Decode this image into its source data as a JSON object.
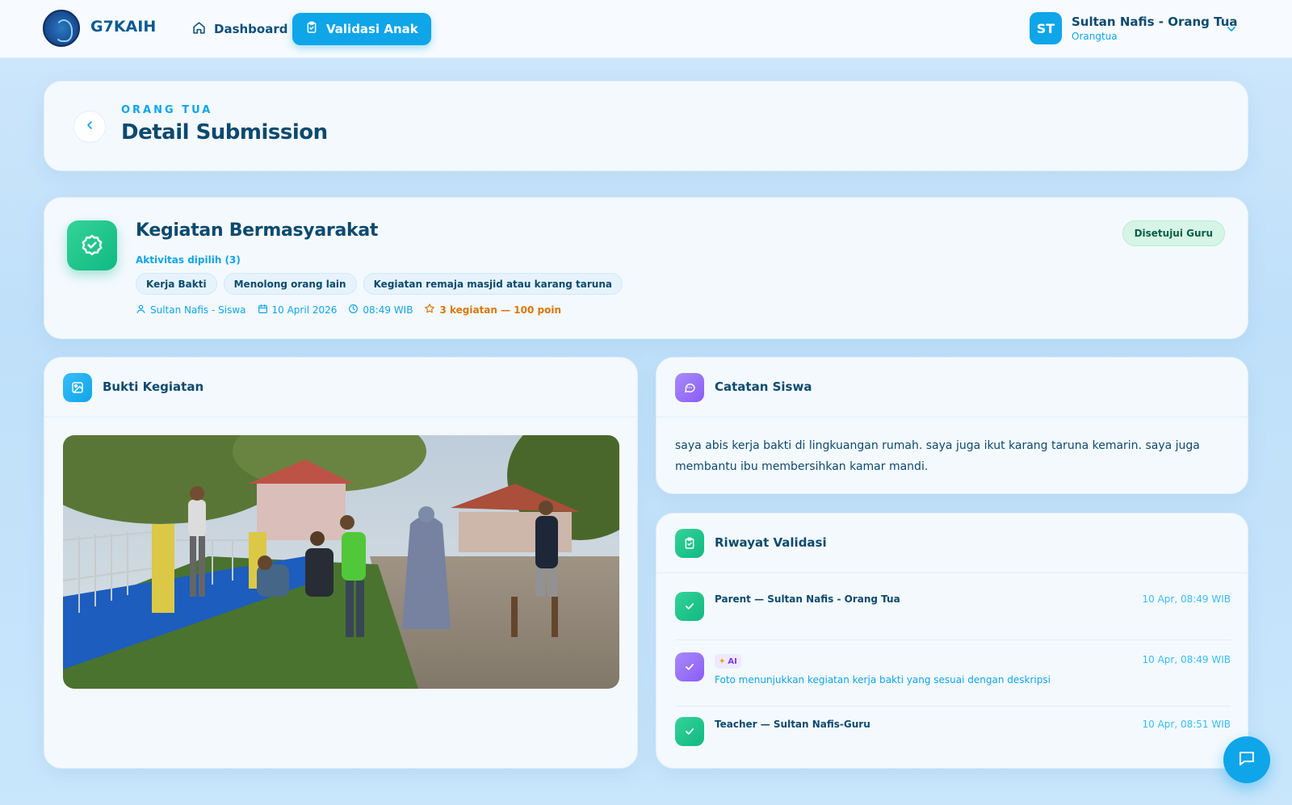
{
  "app": {
    "brand": "G7KAIH"
  },
  "nav": {
    "dashboard": "Dashboard",
    "validasi": "Validasi Anak"
  },
  "user": {
    "initials": "ST",
    "name": "Sultan Nafis - Orang Tua",
    "role": "Orangtua"
  },
  "header": {
    "overline": "ORANG TUA",
    "title": "Detail Submission"
  },
  "activity": {
    "title": "Kegiatan Bermasyarakat",
    "selected_label": "Aktivitas dipilih (3)",
    "chips": [
      "Kerja Bakti",
      "Menolong orang lain",
      "Kegiatan remaja masjid atau karang taruna"
    ],
    "student": "Sultan Nafis - Siswa",
    "date": "10 April 2026",
    "time": "08:49 WIB",
    "points": "3 kegiatan — 100 poin",
    "status": "Disetujui Guru"
  },
  "bukti": {
    "title": "Bukti Kegiatan"
  },
  "catatan": {
    "title": "Catatan Siswa",
    "text": "saya abis kerja bakti di lingkuangan rumah. saya juga ikut karang taruna kemarin. saya juga membantu ibu membersihkan kamar mandi."
  },
  "riwayat": {
    "title": "Riwayat Validasi",
    "items": [
      {
        "title": "Parent — Sultan Nafis - Orang Tua",
        "time": "10 Apr, 08:49 WIB"
      },
      {
        "badge": "AI",
        "desc": "Foto menunjukkan kegiatan kerja bakti yang sesuai dengan deskripsi",
        "time": "10 Apr, 08:49 WIB"
      },
      {
        "title": "Teacher — Sultan Nafis-Guru",
        "time": "10 Apr, 08:51 WIB"
      }
    ]
  },
  "colors": {
    "accent": "#0ea5e9",
    "success": "#10b981",
    "ai": "#8b5cf6",
    "points": "#d97706"
  },
  "icons": [
    "logo-emblem",
    "home-icon",
    "clipboard-check-icon",
    "chevron-down-icon",
    "chevron-left-icon",
    "badge-check-icon",
    "user-icon",
    "calendar-icon",
    "clock-icon",
    "star-icon",
    "image-icon",
    "message-icon",
    "check-icon",
    "sparkle-icon",
    "chat-icon"
  ]
}
